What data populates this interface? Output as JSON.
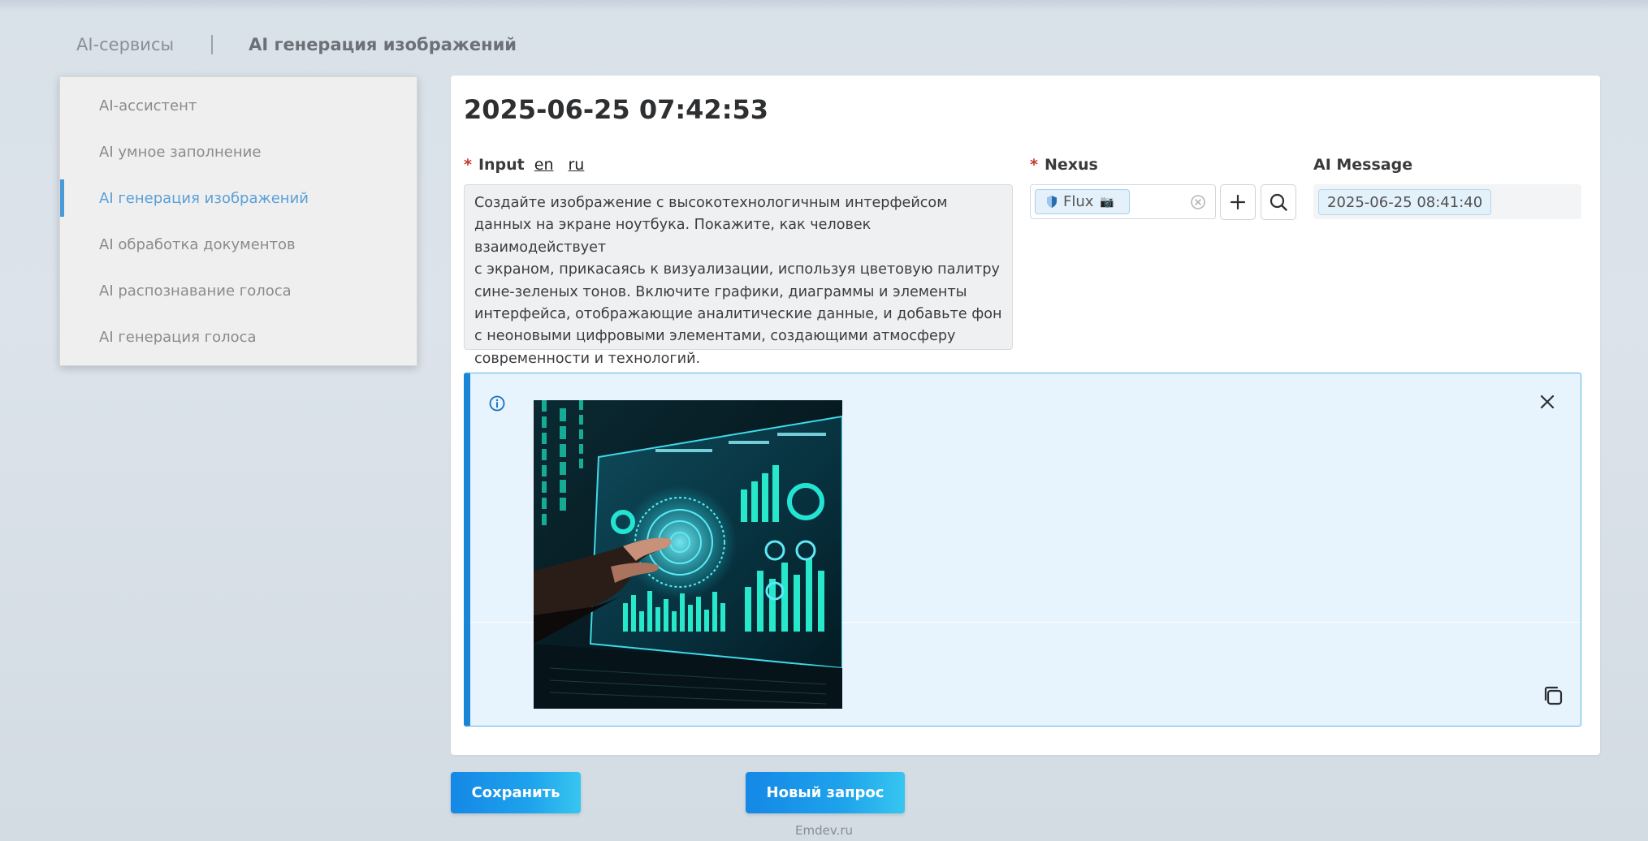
{
  "breadcrumb": {
    "root": "AI-сервисы",
    "current": "AI генерация изображений"
  },
  "sidebar": {
    "items": [
      {
        "label": "AI-ассистент",
        "active": false
      },
      {
        "label": "AI умное заполнение",
        "active": false
      },
      {
        "label": "AI генерация изображений",
        "active": true
      },
      {
        "label": "AI обработка документов",
        "active": false
      },
      {
        "label": "AI распознавание голоса",
        "active": false
      },
      {
        "label": "AI генерация голоса",
        "active": false
      }
    ]
  },
  "main": {
    "title": "2025-06-25 07:42:53",
    "input": {
      "required_mark": "*",
      "label": "Input",
      "lang_en": "en",
      "lang_ru": "ru",
      "value": "Создайте изображение с высокотехнологичным интерфейсом\nданных на экране ноутбука. Покажите, как человек взаимодействует\nс экраном, прикасаясь к визуализации, используя цветовую палитру\nсине-зеленых тонов. Включите графики, диаграммы и элементы\nинтерфейса, отображающие аналитические данные, и добавьте фон\nс неоновыми цифровыми элементами, создающими атмосферу\nсовременности и технологий."
    },
    "nexus": {
      "required_mark": "*",
      "label": "Nexus",
      "tag": "Flux",
      "tag_emoji": "📷"
    },
    "ai_message": {
      "label": "AI Message",
      "value": "2025-06-25 08:41:40"
    },
    "result": {
      "image_description": "generated image: hand touching a teal data-visualization screen on a laptop"
    }
  },
  "actions": {
    "save": "Сохранить",
    "new_request": "Новый запрос"
  },
  "footer": {
    "text": "Emdev.ru"
  },
  "colors": {
    "accent": "#1a86d8",
    "sidebar_active": "#5aa0d8",
    "required": "#c0392b",
    "result_bg": "#e7f3fd"
  },
  "icons": [
    "info-icon",
    "close-icon",
    "copy-icon",
    "clear-icon",
    "plus-icon",
    "search-icon",
    "shield-icon"
  ]
}
